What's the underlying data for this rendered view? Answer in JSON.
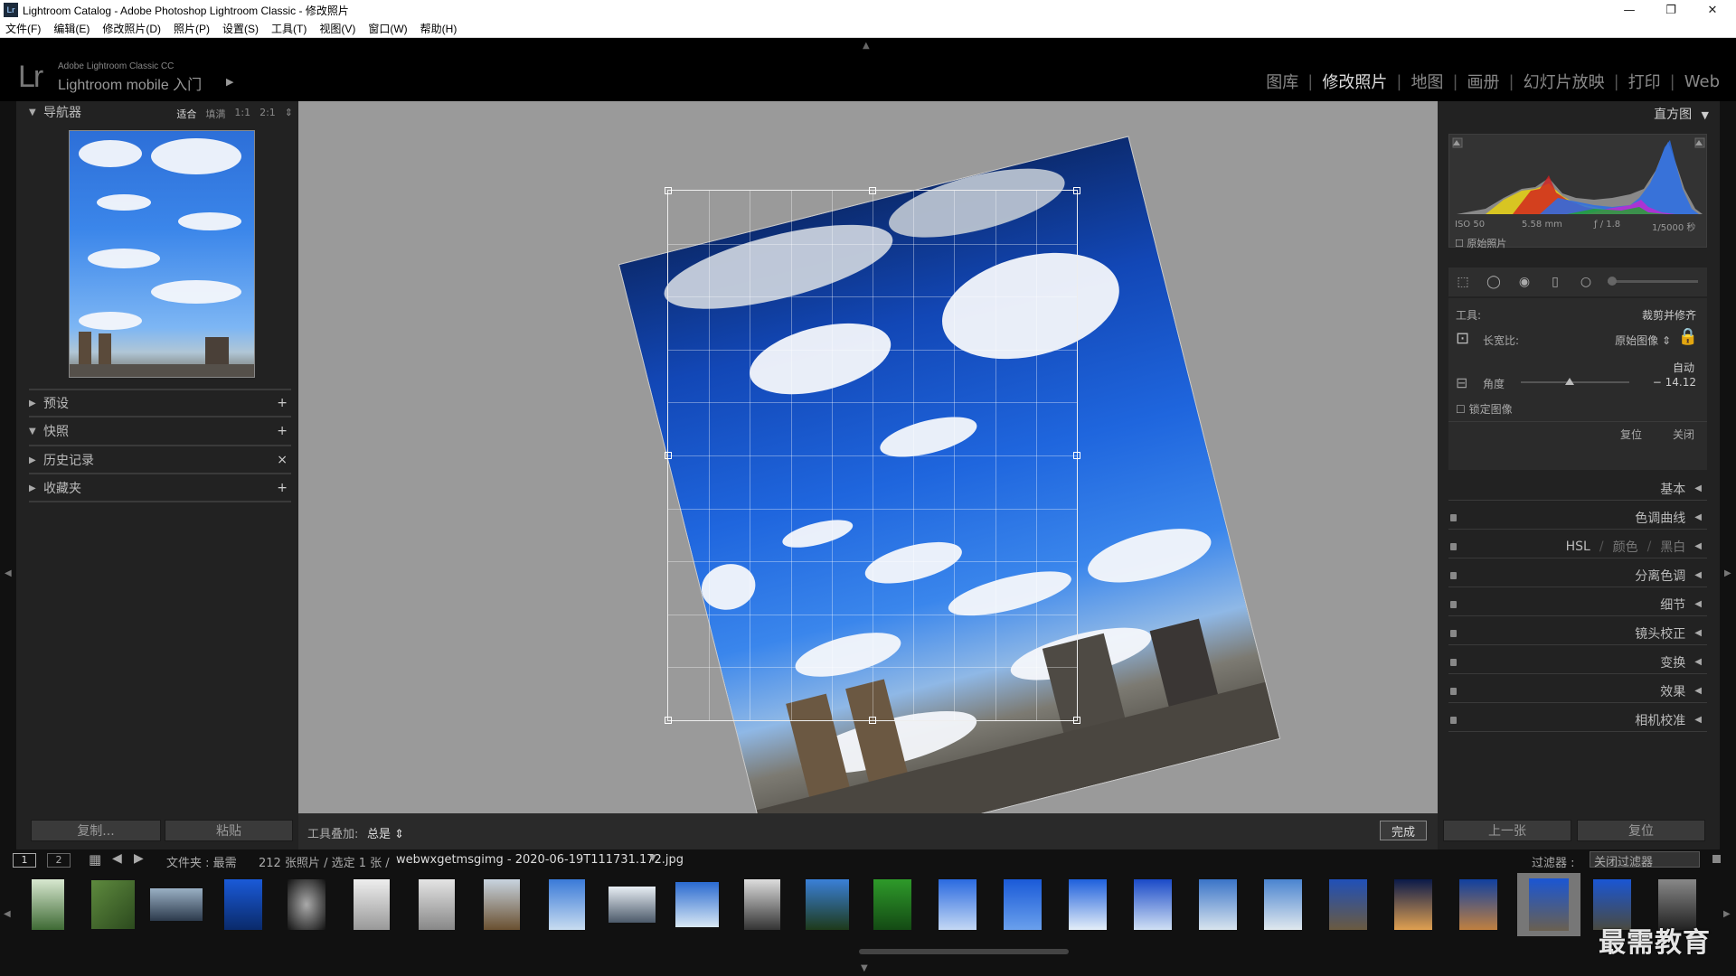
{
  "window": {
    "title": "Lightroom Catalog - Adobe Photoshop Lightroom Classic - 修改照片",
    "app_badge": "Lr",
    "controls": [
      "—",
      "❐",
      "✕"
    ]
  },
  "menu": [
    "文件(F)",
    "编辑(E)",
    "修改照片(D)",
    "照片(P)",
    "设置(S)",
    "工具(T)",
    "视图(V)",
    "窗口(W)",
    "帮助(H)"
  ],
  "identity": {
    "logo": "Lr",
    "product": "Adobe Lightroom Classic CC",
    "mobile": "Lightroom mobile 入门"
  },
  "modules": [
    {
      "label": "图库",
      "active": false
    },
    {
      "label": "修改照片",
      "active": true
    },
    {
      "label": "地图",
      "active": false
    },
    {
      "label": "画册",
      "active": false
    },
    {
      "label": "幻灯片放映",
      "active": false
    },
    {
      "label": "打印",
      "active": false
    },
    {
      "label": "Web",
      "active": false
    }
  ],
  "left": {
    "navigator": {
      "title": "导航器",
      "zoom": [
        "适合",
        "填满",
        "1:1",
        "2:1"
      ],
      "zoom_active": "适合"
    },
    "panels": [
      {
        "title": "预设",
        "action": "+"
      },
      {
        "title": "快照",
        "action": "+"
      },
      {
        "title": "历史记录",
        "action": "×"
      },
      {
        "title": "收藏夹",
        "action": "+"
      }
    ],
    "copy_button": "复制...",
    "paste_button": "粘贴"
  },
  "toolbar": {
    "overlay_label": "工具叠加:",
    "overlay_value": "总是",
    "done_button": "完成"
  },
  "right": {
    "histogram": {
      "title": "直方图",
      "iso": "ISO 50",
      "focal": "5.58 mm",
      "aperture": "ƒ / 1.8",
      "shutter": "1/5000 秒",
      "original_label": "原始照片"
    },
    "crop": {
      "tool_label": "工具:",
      "tool_name": "裁剪并修齐",
      "aspect_label": "长宽比:",
      "aspect_value": "原始图像",
      "auto_label": "自动",
      "angle_label": "角度",
      "angle_value": "− 14.12",
      "angle_fraction": 0.45,
      "lock_label": "锁定图像",
      "reset_button": "复位",
      "close_button": "关闭"
    },
    "panels": [
      "基本",
      "色调曲线",
      "HSL",
      "颜色",
      "黑白",
      "分离色调",
      "细节",
      "镜头校正",
      "变换",
      "效果",
      "相机校准"
    ],
    "prev_button": "上一张",
    "reset_button": "复位"
  },
  "filmstrip": {
    "page1": "1",
    "page2": "2",
    "source": "文件夹 : 最需",
    "count": "212 张照片 / 选定 1 张 /",
    "filename": "webwxgetmsgimg - 2020-06-19T111731.172.jpg",
    "filter_label": "过滤器 :",
    "filter_value": "关闭过滤器"
  },
  "watermark": "最需教育"
}
